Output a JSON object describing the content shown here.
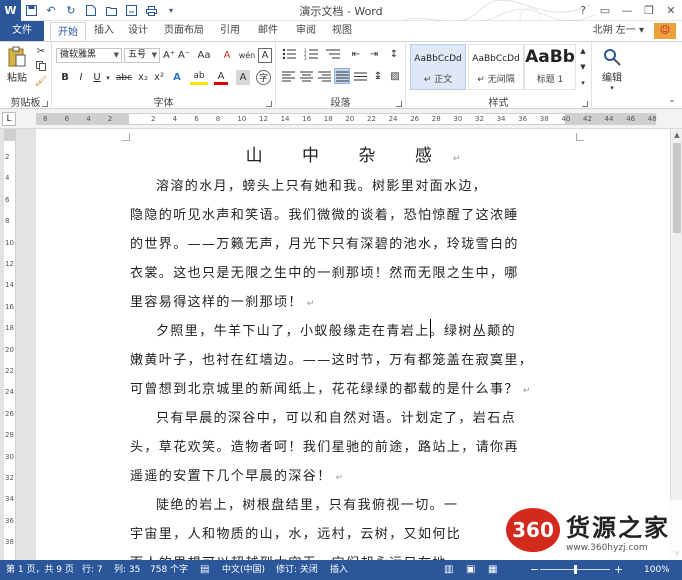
{
  "window": {
    "title": "演示文档 - Word",
    "app_icon": "W",
    "controls": [
      "?",
      "▭",
      "—",
      "❐",
      "✕"
    ]
  },
  "qat": {
    "icons": [
      "save-icon",
      "undo-icon",
      "redo-icon",
      "new-doc-icon",
      "open-icon",
      "save-as-icon",
      "print-icon",
      "qat-more-icon"
    ]
  },
  "tabs": {
    "file": "文件",
    "items": [
      "开始",
      "插入",
      "设计",
      "页面布局",
      "引用",
      "邮件",
      "审阅",
      "视图"
    ],
    "active": "开始",
    "user": "北朔 左一 ▾"
  },
  "ribbon": {
    "clipboard": {
      "label": "剪贴板",
      "paste": "粘贴"
    },
    "font": {
      "label": "字体",
      "font_name": "微软雅黑",
      "font_size": "五号",
      "grow": "A⁺",
      "shrink": "A⁻",
      "change_case": "Aa",
      "clear_format": "A",
      "phonetic": "wén",
      "border": "A",
      "bold": "B",
      "italic": "I",
      "underline": "U",
      "strike": "abc",
      "subscript": "x₂",
      "superscript": "x²",
      "effects": "A",
      "highlight": "ab",
      "color": "A",
      "shade": "A",
      "circle": "字"
    },
    "paragraph": {
      "label": "段落"
    },
    "styles": {
      "label": "样式",
      "items": [
        {
          "sample": "AaBbCcDd",
          "name": "↵ 正文"
        },
        {
          "sample": "AaBbCcDd",
          "name": "↵ 无间隔"
        },
        {
          "sample": "AaBb",
          "name": "标题 1"
        }
      ]
    },
    "editing": {
      "label": "编辑"
    }
  },
  "ruler": {
    "tab_selector": "L",
    "ticks": [
      "8",
      "6",
      "4",
      "2",
      "",
      "2",
      "4",
      "6",
      "8",
      "10",
      "12",
      "14",
      "16",
      "18",
      "20",
      "22",
      "24",
      "26",
      "28",
      "30",
      "32",
      "34",
      "36",
      "38",
      "40",
      "42",
      "44",
      "46",
      "48"
    ]
  },
  "vruler": {
    "ticks": [
      "2",
      "4",
      "6",
      "8",
      "10",
      "12",
      "14",
      "16",
      "18",
      "20",
      "22",
      "24",
      "26",
      "28",
      "30",
      "32",
      "34",
      "36",
      "38"
    ]
  },
  "document": {
    "title": "山 中 杂 感",
    "lines": [
      "溶溶的水月，螃头上只有她和我。树影里对面水边，",
      "隐隐的听见水声和笑语。我们微微的谈着，恐怕惊醒了这浓睡",
      "的世界。——万籁无声，月光下只有深碧的池水，玲珑雪白的",
      "衣裳。这也只是无限之生中的一刹那顷！然而无限之生中，哪",
      "里容易得这样的一刹那顷！",
      "夕照里，牛羊下山了，小蚁般缘走在青岩上。绿树丛颠的",
      "嫩黄叶子，也衬在红墙边。——这时节，万有都笼盖在寂寞里，",
      "可曾想到北京城里的新闻纸上，花花绿绿的都载的是什么事？",
      "只有早晨的深谷中，可以和自然对语。计划定了，岩石点",
      "头，草花欢笑。造物者呵！我们星驰的前途，路站上，请你再",
      "遥遥的安置下几个早晨的深谷！",
      "陡绝的岩上，树根盘结里，只有我俯视一切。一",
      "宇宙里，人和物质的山，水，远村，云树，又如何比",
      "而人的思想可以超越到太空无，它们却永远只在地"
    ],
    "para_marks": [
      "",
      "",
      "",
      "",
      "↵",
      "",
      "",
      "↵",
      "",
      "",
      "↵",
      "",
      "",
      ""
    ]
  },
  "watermark": {
    "badge": "360",
    "name": "货源之家",
    "url": "www.360hyzj.com"
  },
  "status": {
    "page": "第 1 页，共 9 页",
    "line": "行: 7",
    "column": "列: 35",
    "words": "758 个字",
    "language": "中文(中国)",
    "track": "修订: 关闭",
    "mode": "插入",
    "zoom": "100%",
    "zoom_minus": "−",
    "zoom_plus": "+"
  },
  "colors": {
    "accent": "#2b579a",
    "status_bar": "#2b579a"
  }
}
